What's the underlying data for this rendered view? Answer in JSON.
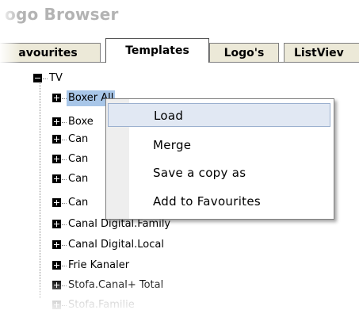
{
  "window": {
    "title": "ogo Browser"
  },
  "tabs": [
    {
      "label": "avourites"
    },
    {
      "label": "Templates"
    },
    {
      "label": "Logo's"
    },
    {
      "label": "ListViev"
    }
  ],
  "tree": {
    "root": "TV",
    "items": [
      "Boxer All",
      "Boxe",
      "Can",
      "Can",
      "Can",
      "Can",
      "Canal Digital.Family",
      "Canal Digital.Local",
      "Frie Kanaler",
      "Stofa.Canal+ Total",
      "Stofa.Familie"
    ]
  },
  "context_menu": {
    "items": [
      {
        "label": "Load"
      },
      {
        "label": "Merge"
      },
      {
        "label": "Save a copy as"
      },
      {
        "label": "Add to Favourites"
      }
    ]
  }
}
